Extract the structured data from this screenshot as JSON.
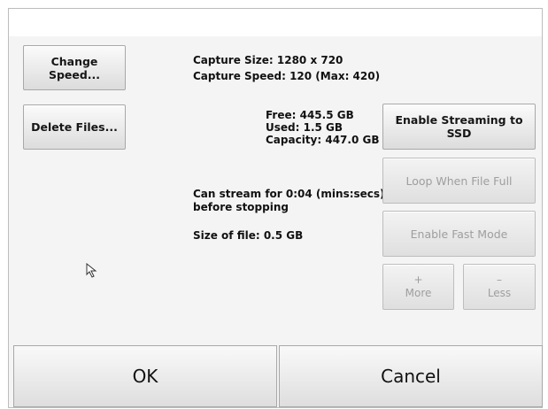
{
  "buttons": {
    "change_speed": "Change Speed...",
    "delete_files": "Delete Files...",
    "enable_streaming": "Enable Streaming to SSD",
    "loop_when_full": "Loop When File Full",
    "enable_fast_mode": "Enable Fast Mode",
    "more_symbol": "+",
    "more_label": "More",
    "less_symbol": "–",
    "less_label": "Less",
    "ok": "OK",
    "cancel": "Cancel"
  },
  "capture": {
    "size": "Capture Size: 1280 x 720",
    "speed": "Capture Speed: 120  (Max: 420)"
  },
  "disk": {
    "free": "Free: 445.5 GB",
    "used": "Used: 1.5 GB",
    "capacity": "Capacity: 447.0 GB"
  },
  "stream": {
    "line1": "Can stream for 0:04 (mins:secs)",
    "line2": "before stopping",
    "file_size": "Size of file: 0.5 GB"
  },
  "icons": {
    "cursor": "mouse-pointer-icon"
  }
}
